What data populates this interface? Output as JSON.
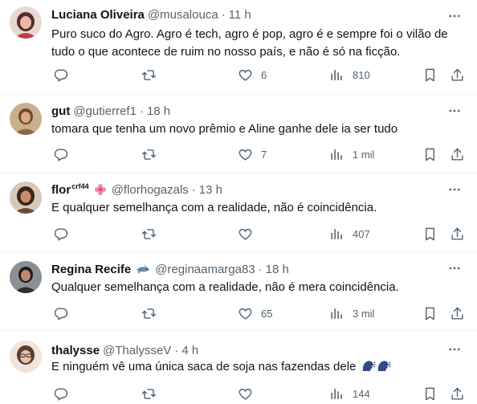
{
  "tweets": [
    {
      "name": "Luciana Oliveira",
      "name_sup": "",
      "handle": "@musalouca",
      "dot": "·",
      "time": "11 h",
      "text": "Puro suco do Agro. Agro é tech, agro é pop, agro é e sempre foi o vilão de tudo o que acontece de ruim no nosso país, e não é só na ficção.",
      "replies": "",
      "retweets": "",
      "likes": "6",
      "views": "810",
      "avatar_bg": "#c6384a"
    },
    {
      "name": "gut",
      "name_sup": "",
      "handle": "@gutierref1",
      "dot": "·",
      "time": "18 h",
      "text": "tomara que tenha um novo prêmio e Aline ganhe dele ia ser tudo",
      "replies": "",
      "retweets": "",
      "likes": "7",
      "views": "1 mil",
      "avatar_bg": "#9a7a52"
    },
    {
      "name": "flor",
      "name_sup": "crf44",
      "handle": "@florhogazals",
      "dot": "·",
      "time": "13 h",
      "text": "E qualquer semelhança com a realidade, não é coincidência.",
      "replies": "",
      "retweets": "",
      "likes": "",
      "views": "407",
      "avatar_bg": "#6b4a36"
    },
    {
      "name": "Regina Recife",
      "name_sup": "",
      "handle": "@reginaamarga83",
      "dot": "·",
      "time": "18 h",
      "text": "Qualquer semelhança com a realidade, não é mera coincidência.",
      "replies": "",
      "retweets": "",
      "likes": "65",
      "views": "3 mil",
      "avatar_bg": "#3c4148"
    },
    {
      "name": "thalysse",
      "name_sup": "",
      "handle": "@ThalysseV",
      "dot": "·",
      "time": "4 h",
      "text": "E ninguém vê uma única saca de soja nas fazendas dele",
      "replies": "",
      "retweets": "",
      "likes": "",
      "views": "144",
      "avatar_bg": "#d9c4b4"
    }
  ],
  "colors": {
    "text": "#0f1419",
    "secondary": "#536471",
    "divider": "#eff3f4",
    "flower_badge": "#e0457b",
    "shark_badge": "#6b8aa3",
    "speaking_head": "#34498a"
  },
  "icons": {
    "more": "more-dots-icon",
    "reply": "reply-icon",
    "retweet": "retweet-icon",
    "like": "heart-icon",
    "views": "views-chart-icon",
    "bookmark": "bookmark-icon",
    "share": "share-icon",
    "flower_badge": "flower-emoji-icon",
    "shark_badge": "shark-emoji-icon",
    "speaking_head": "speaking-head-emoji-icon"
  }
}
